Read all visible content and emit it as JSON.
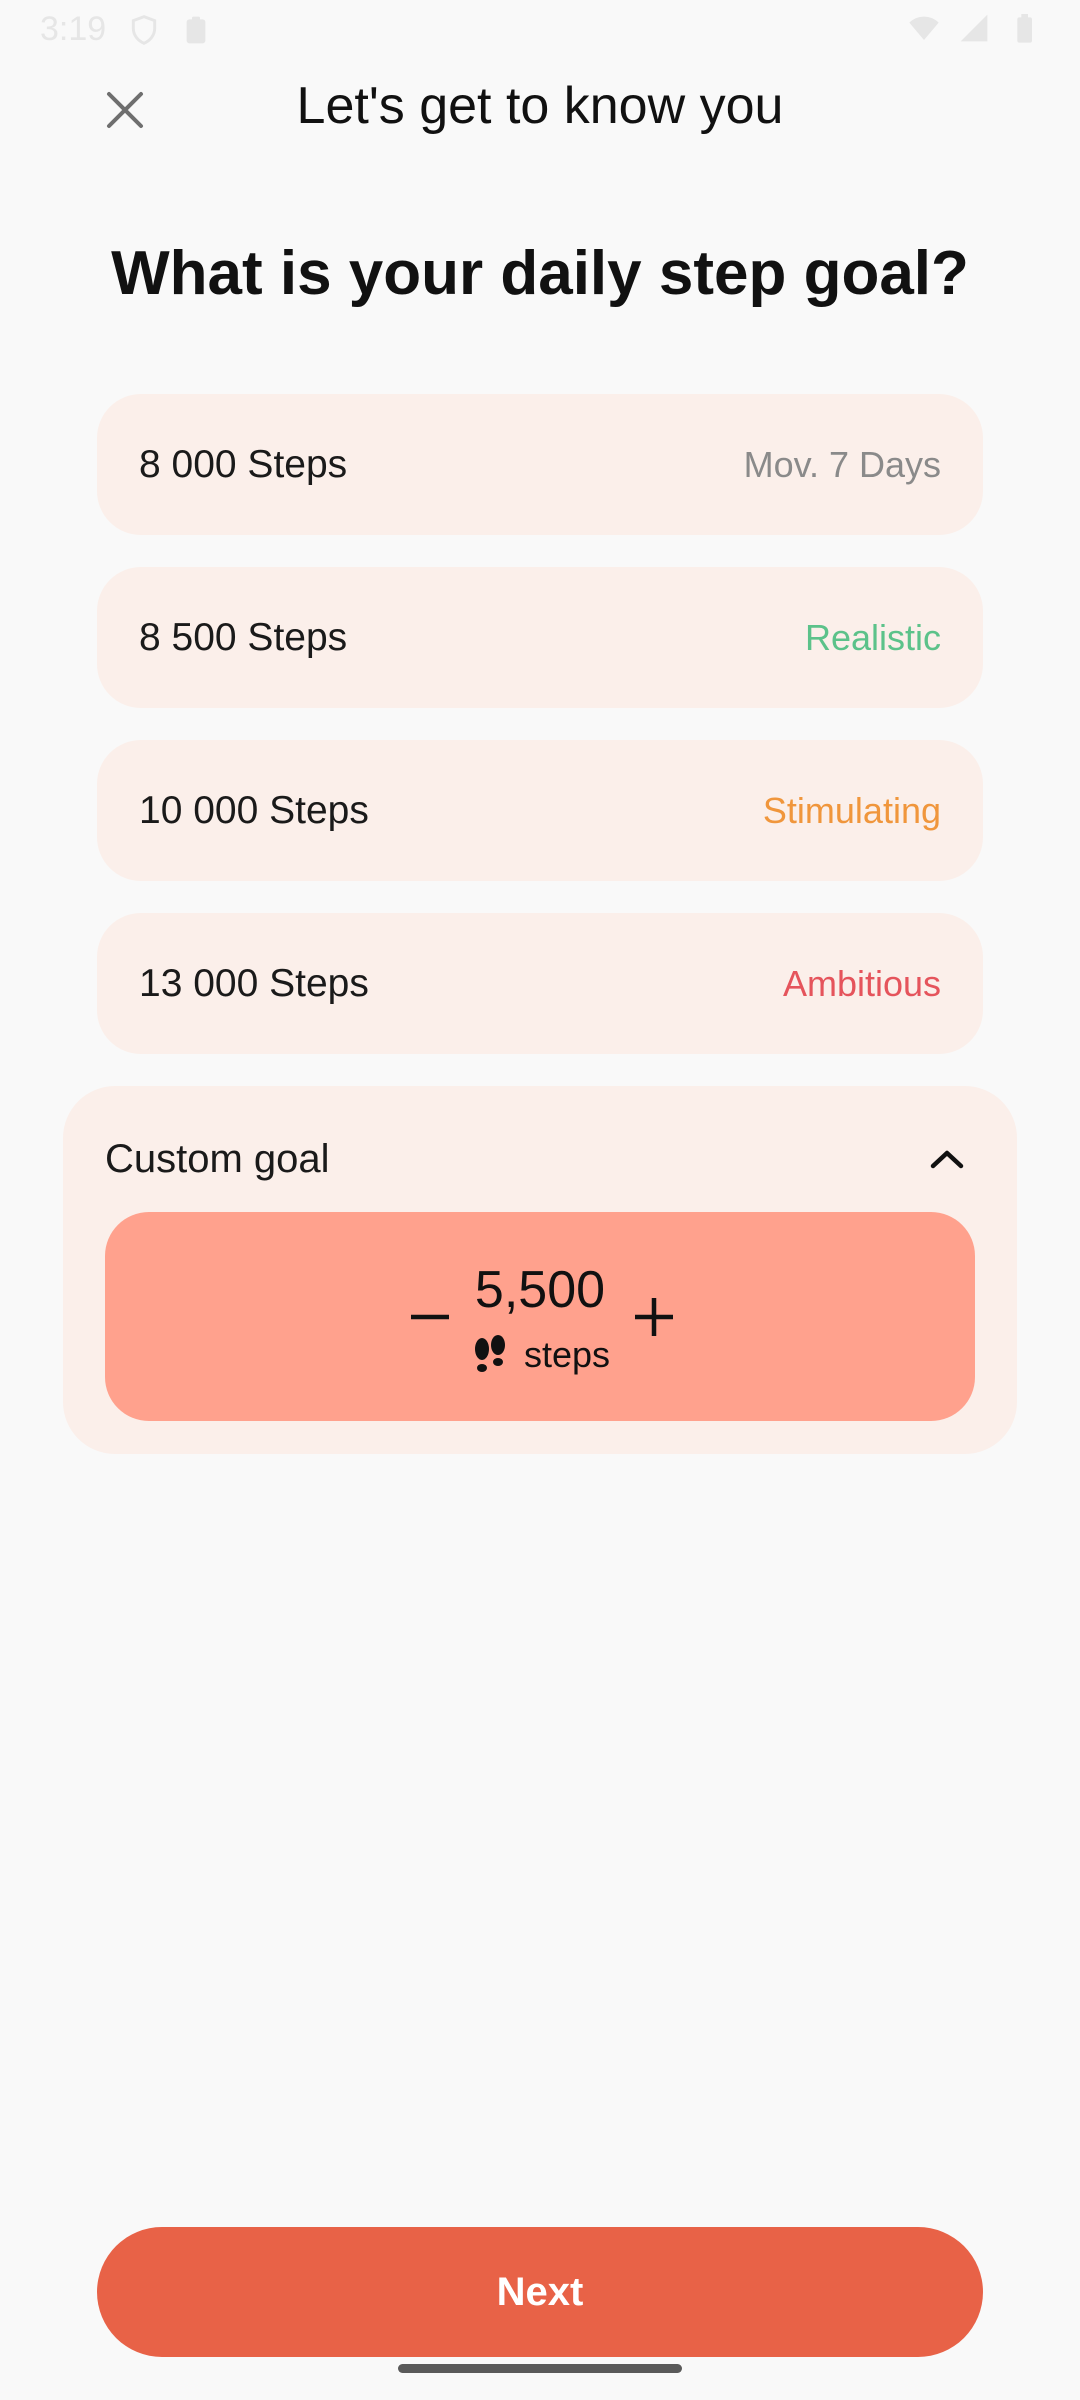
{
  "status_bar": {
    "time": "3:19",
    "left_icons": [
      "shield-icon",
      "clipboard-icon"
    ],
    "right_icons": [
      "wifi-icon",
      "signal-icon",
      "battery-icon"
    ]
  },
  "header": {
    "title": "Let's get to know you",
    "close_icon": "close-icon"
  },
  "question": "What is your daily step goal?",
  "options": [
    {
      "label": "8 000 Steps",
      "tag": "Mov. 7 Days",
      "tag_color": "#8a8a8a"
    },
    {
      "label": "8 500 Steps",
      "tag": "Realistic",
      "tag_color": "#5cc28a"
    },
    {
      "label": "10 000 Steps",
      "tag": "Stimulating",
      "tag_color": "#f0963c"
    },
    {
      "label": "13 000 Steps",
      "tag": "Ambitious",
      "tag_color": "#e5545c"
    }
  ],
  "custom_goal": {
    "title": "Custom goal",
    "expanded": true,
    "value": "5,500",
    "unit": "steps",
    "unit_icon": "footprints-icon"
  },
  "next_button": {
    "label": "Next"
  },
  "colors": {
    "background": "#f9f9f9",
    "card": "#fbefea",
    "stepper": "#ffa18d",
    "accent": "#e86247"
  }
}
